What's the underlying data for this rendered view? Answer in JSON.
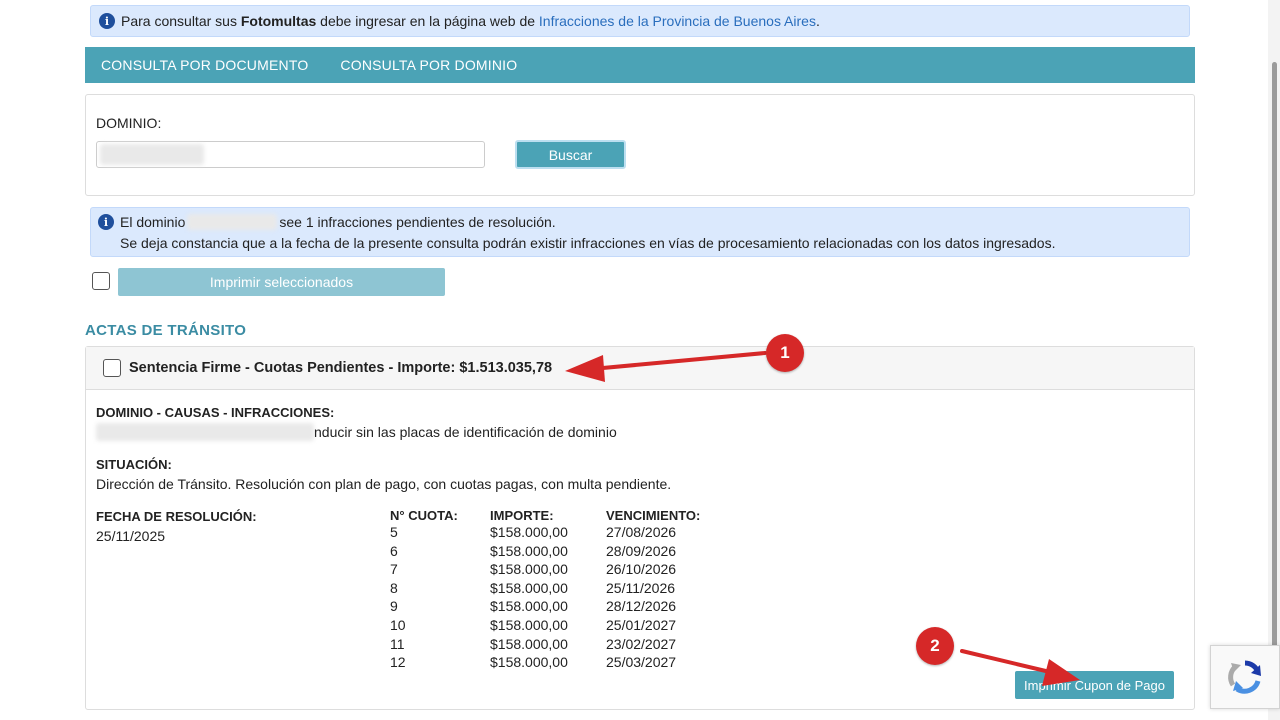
{
  "info_banner": {
    "text_before": "Para consultar sus ",
    "bold": "Fotomultas",
    "text_middle": " debe ingresar en la página web de ",
    "link": "Infracciones de la Provincia de Buenos Aires",
    "text_after": "."
  },
  "tabs": [
    {
      "label": "CONSULTA POR DOCUMENTO"
    },
    {
      "label": "CONSULTA POR DOMINIO"
    }
  ],
  "search": {
    "label": "DOMINIO:",
    "button": "Buscar"
  },
  "result": {
    "line1_before": "El dominio",
    "line1_after": "see 1 infracciones pendientes de resolución.",
    "line2": "Se deja constancia que a la fecha de la presente consulta podrán existir infracciones en vías de procesamiento relacionadas con los datos ingresados."
  },
  "print_selected": "Imprimir seleccionados",
  "section_title": "ACTAS DE TRÁNSITO",
  "acta": {
    "title": "Sentencia Firme - Cuotas Pendientes  -  Importe: $1.513.035,78",
    "causas_label": "DOMINIO - CAUSAS - INFRACCIONES:",
    "causas_value": "nducir sin las placas de identificación de dominio",
    "situacion_label": "SITUACIÓN:",
    "situacion_value": "Dirección de Tránsito. Resolución con plan de pago, con cuotas pagas, con multa pendiente.",
    "fecha_label": "FECHA DE RESOLUCIÓN:",
    "fecha_value": "25/11/2025",
    "cuotas_headers": {
      "numero": "N° CUOTA:",
      "importe": "IMPORTE:",
      "vencimiento": "VENCIMIENTO:"
    },
    "cuotas": [
      {
        "numero": "5",
        "importe": "$158.000,00",
        "vencimiento": "27/08/2026"
      },
      {
        "numero": "6",
        "importe": "$158.000,00",
        "vencimiento": "28/09/2026"
      },
      {
        "numero": "7",
        "importe": "$158.000,00",
        "vencimiento": "26/10/2026"
      },
      {
        "numero": "8",
        "importe": "$158.000,00",
        "vencimiento": "25/11/2026"
      },
      {
        "numero": "9",
        "importe": "$158.000,00",
        "vencimiento": "28/12/2026"
      },
      {
        "numero": "10",
        "importe": "$158.000,00",
        "vencimiento": "25/01/2027"
      },
      {
        "numero": "11",
        "importe": "$158.000,00",
        "vencimiento": "23/02/2027"
      },
      {
        "numero": "12",
        "importe": "$158.000,00",
        "vencimiento": "25/03/2027"
      }
    ],
    "cupon_button": "Imprimir Cupon de Pago"
  },
  "annotations": [
    {
      "number": "1"
    },
    {
      "number": "2"
    }
  ],
  "colors": {
    "accent": "#4ba3b6",
    "info_bg": "#dbe9fd",
    "section_title": "#3b8ca3",
    "annotation_red": "#d62828"
  },
  "icons": [
    "info-icon",
    "recaptcha-icon"
  ]
}
